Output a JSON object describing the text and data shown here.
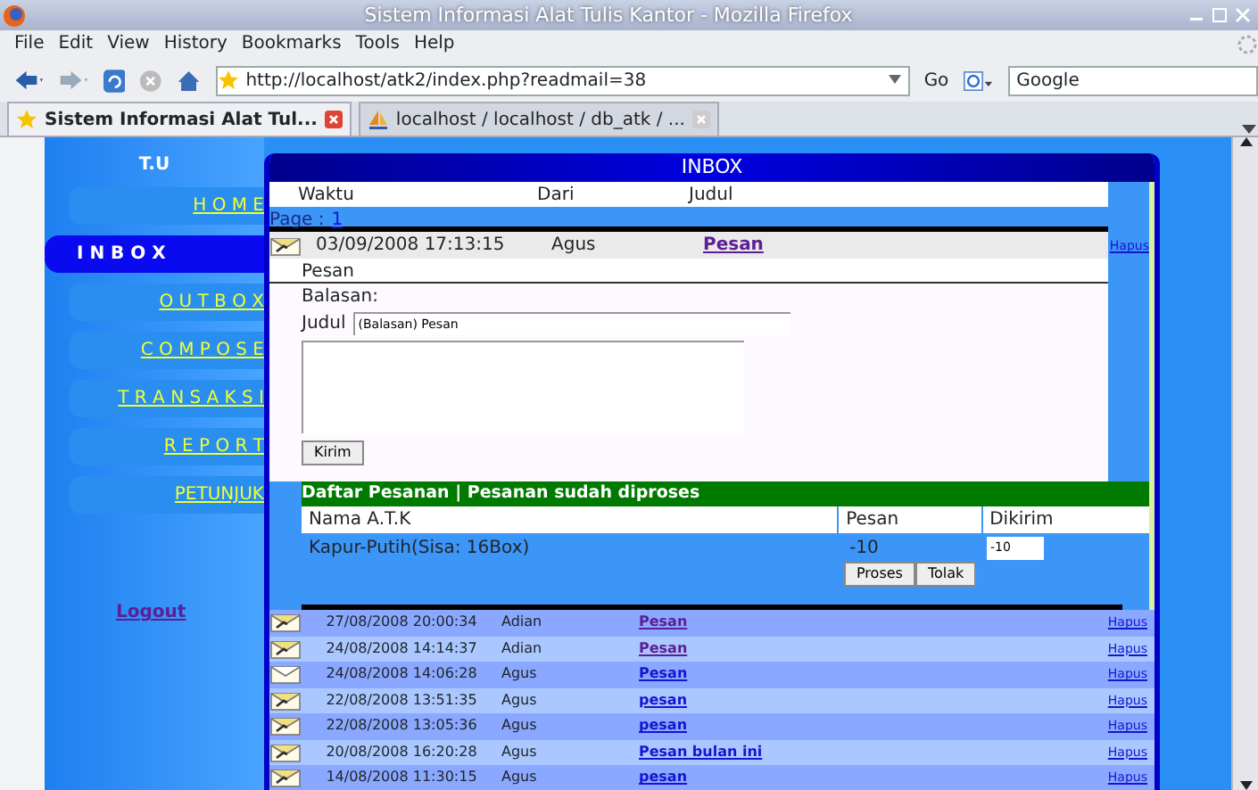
{
  "window": {
    "title": "Sistem Informasi Alat Tulis Kantor - Mozilla Firefox"
  },
  "menu_bar": [
    "File",
    "Edit",
    "View",
    "History",
    "Bookmarks",
    "Tools",
    "Help"
  ],
  "toolbar": {
    "url": "http://localhost/atk2/index.php?readmail=38",
    "go_label": "Go",
    "search_value": "Google"
  },
  "tabs": [
    {
      "label": "Sistem Informasi Alat Tul...",
      "selected": true
    },
    {
      "label": "localhost / localhost / db_atk / ...",
      "selected": false
    }
  ],
  "sidebar": {
    "title": "T.U",
    "items": [
      {
        "label": "H O M E",
        "selected": false
      },
      {
        "label": "I N B O X",
        "selected": true
      },
      {
        "label": "O U T B O X",
        "selected": false
      },
      {
        "label": "C O M P O S E",
        "selected": false
      },
      {
        "label": "T R A N S A K S I",
        "selected": false
      },
      {
        "label": "R E P O R T",
        "selected": false
      },
      {
        "label": "PETUNJUK",
        "selected": false
      }
    ],
    "logout": "Logout"
  },
  "inbox": {
    "title": "INBOX",
    "columns": [
      "Waktu",
      "Dari",
      "Judul"
    ],
    "page_label": "Page :",
    "pages": [
      "1"
    ],
    "open_message": {
      "time": "03/09/2008 17:13:15",
      "sender": "Agus",
      "subject": "Pesan",
      "delete": "Hapus",
      "body": "Pesan",
      "reply_label": "Balasan:",
      "subject_label": "Judul",
      "subject_value": "(Balasan) Pesan",
      "send_button": "Kirim"
    },
    "order": {
      "title": "Daftar Pesanan | Pesanan sudah diproses",
      "columns": [
        "Nama A.T.K",
        "Pesan",
        "Dikirim"
      ],
      "items": [
        {
          "name": "Kapur-Putih(Sisa: 16Box)",
          "ordered": "-10",
          "sent_value": "-10"
        }
      ],
      "buttons": [
        "Proses",
        "Tolak"
      ]
    },
    "messages": [
      {
        "time": "27/08/2008 20:00:34",
        "sender": "Adian",
        "subject": "Pesan",
        "delete": "Hapus",
        "read": true,
        "visited": true
      },
      {
        "time": "24/08/2008 14:14:37",
        "sender": "Adian",
        "subject": "Pesan",
        "delete": "Hapus",
        "read": true,
        "visited": true
      },
      {
        "time": "24/08/2008 14:06:28",
        "sender": "Agus",
        "subject": "Pesan",
        "delete": "Hapus",
        "read": false,
        "visited": false
      },
      {
        "time": "22/08/2008 13:51:35",
        "sender": "Agus",
        "subject": "pesan",
        "delete": "Hapus",
        "read": true,
        "visited": false
      },
      {
        "time": "22/08/2008 13:05:36",
        "sender": "Agus",
        "subject": "pesan",
        "delete": "Hapus",
        "read": true,
        "visited": false
      },
      {
        "time": "20/08/2008 16:20:28",
        "sender": "Agus",
        "subject": "Pesan bulan ini",
        "delete": "Hapus",
        "read": true,
        "visited": false
      },
      {
        "time": "14/08/2008 11:30:15",
        "sender": "Agus",
        "subject": "pesan",
        "delete": "Hapus",
        "read": true,
        "visited": false
      }
    ]
  }
}
